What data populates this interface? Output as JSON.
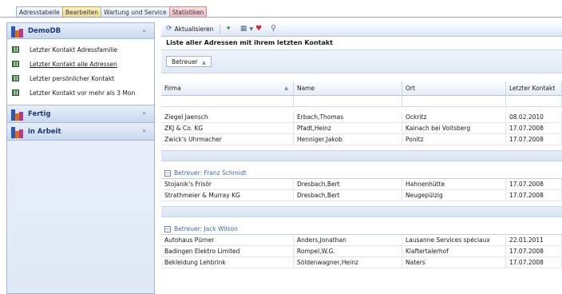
{
  "tabs": [
    {
      "label": "Adresstabelle",
      "state": "normal"
    },
    {
      "label": "Bearbeiten",
      "state": "active"
    },
    {
      "label": "Wartung und Service",
      "state": "normal"
    },
    {
      "label": "Statistiken",
      "state": "stat"
    }
  ],
  "sidebar": {
    "groups": [
      {
        "title": "DemoDB",
        "chevron": "«",
        "items": [
          {
            "label": "Letzter Kontakt Adressfamilie"
          },
          {
            "label": "Letzter Kontakt alle Adressen"
          },
          {
            "label": "Letzter persönlicher Kontakt"
          },
          {
            "label": "Letzter Kontakt vor mehr als 3 Mon"
          }
        ]
      },
      {
        "title": "Fertig",
        "chevron": "»"
      },
      {
        "title": "in Arbeit",
        "chevron": "»"
      }
    ]
  },
  "toolbar": {
    "refresh_label": "Aktualisieren"
  },
  "main": {
    "title": "Liste aller Adressen mit ihrem letzten Kontakt",
    "group_chip": "Betreuer",
    "columns": [
      "Firma",
      "Name",
      "Ort",
      "Letzter Kontakt"
    ],
    "groups": [
      {
        "header": "",
        "rows": [
          [
            "Ziegel Jaensch",
            "Erbach,Thomas",
            "Ockritz",
            "08.02.2010"
          ],
          [
            "ZKJ & Co. KG",
            "Pfadt,Heinz",
            "Kainach bei Voitsberg",
            "17.07.2008"
          ],
          [
            "Zwick's Uhrmacher",
            "Henniger,Jakob",
            "Ponitz",
            "17.07.2008"
          ]
        ]
      },
      {
        "header": "Betreuer: Franz Schmidt",
        "rows": [
          [
            "Stojanik's Frisör",
            "Dresbach,Bert",
            "Hahnenhütte",
            "17.07.2008"
          ],
          [
            "Strathmeier & Murray KG",
            "Dresbach,Bert",
            "Neugepülzig",
            "17.07.2008"
          ]
        ]
      },
      {
        "header": "Betreuer: Jack Wilson",
        "rows": [
          [
            "Autohaus Pürner",
            "Anders,Jonathan",
            "Lausanne Services spéciaux",
            "22.01.2011"
          ],
          [
            "Badingen Elektro Limited",
            "Rompel,W.G.",
            "Klaftertalerhof",
            "17.07.2008"
          ],
          [
            "Bekleidung Lehbrink",
            "Söldenwagner,Heinz",
            "Naters",
            "17.07.2008"
          ]
        ]
      }
    ]
  },
  "colors": {
    "accent": "#1c3a78",
    "group_header_text": "#3f6aa8",
    "active_tab": "#f7d97c",
    "stat_tab": "#f2b2b2"
  }
}
